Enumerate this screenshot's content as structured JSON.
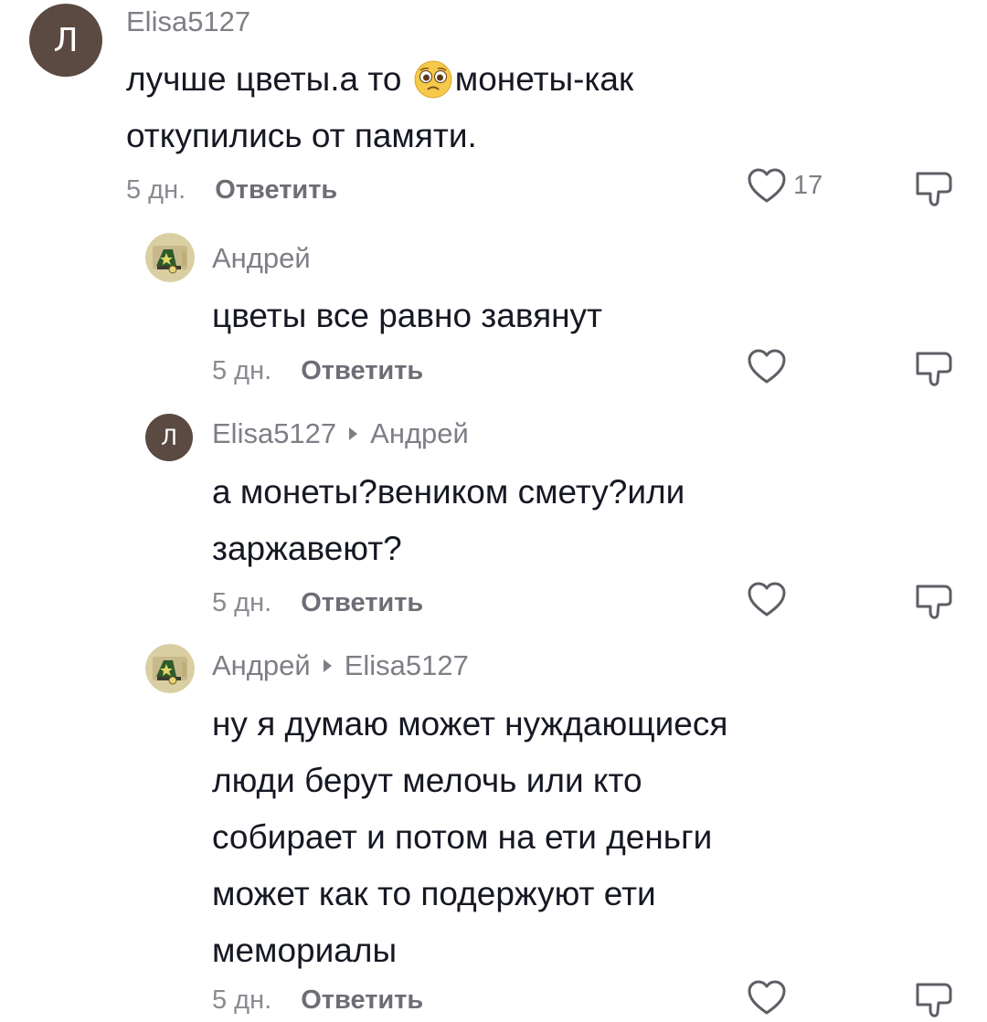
{
  "comments": [
    {
      "avatar_letter": "Л",
      "username": "Elisa5127",
      "reply_to": "",
      "text_lines": [
        "лучше цветы.а то",
        "монеты-как",
        "откупились от памяти."
      ],
      "emoji": "pleading-face-icon",
      "time": "5 дн.",
      "reply_label": "Ответить",
      "likes": "17"
    },
    {
      "avatar_letter": "",
      "username": "Андрей",
      "reply_to": "",
      "text_lines": [
        "цветы все равно завянут"
      ],
      "time": "5 дн.",
      "reply_label": "Ответить",
      "likes": ""
    },
    {
      "avatar_letter": "Л",
      "username": "Elisa5127",
      "reply_to": "Андрей",
      "text_lines": [
        "а монеты?веником смету?или",
        "заржавеют?"
      ],
      "time": "5 дн.",
      "reply_label": "Ответить",
      "likes": ""
    },
    {
      "avatar_letter": "",
      "username": "Андрей",
      "reply_to": "Elisa5127",
      "text_lines": [
        "ну я думаю может нуждающиеся",
        "люди берут мелочь или кто",
        "собирает и потом на ети деньги",
        "может как то подержуют ети",
        "мемориалы"
      ],
      "time": "5 дн.",
      "reply_label": "Ответить",
      "likes": ""
    }
  ],
  "colors": {
    "avatar_letter_bg": "#5a4a41",
    "username": "#7d7f86",
    "text": "#161823",
    "meta": "#8a8b91"
  }
}
